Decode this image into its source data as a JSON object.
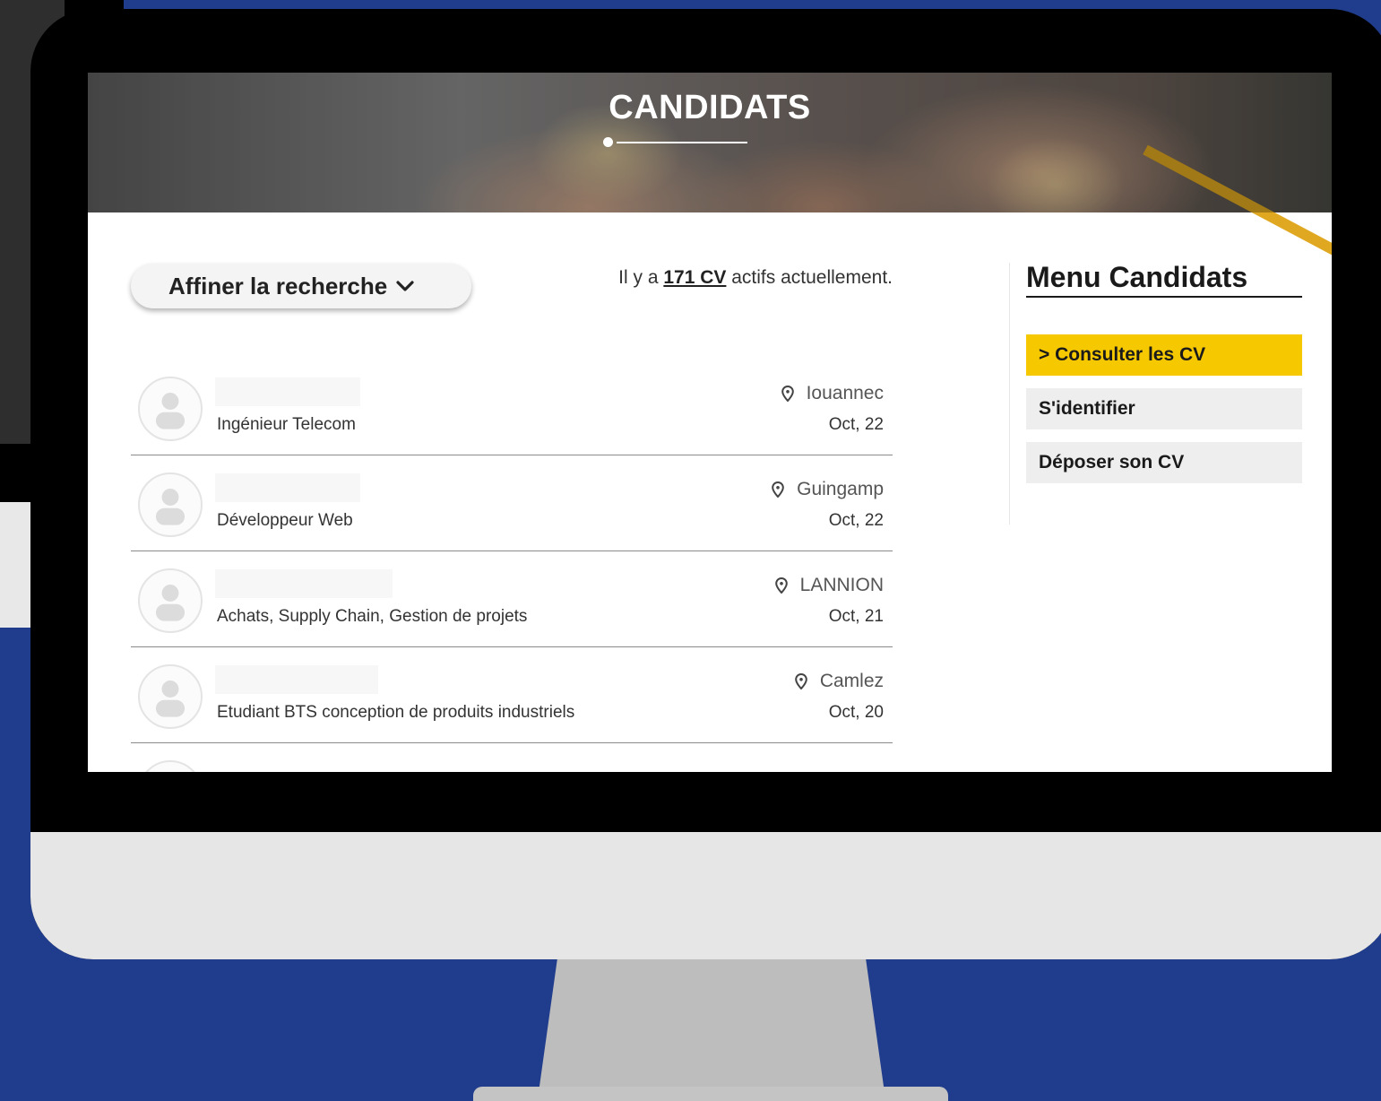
{
  "hero": {
    "title": "CANDIDATS"
  },
  "search": {
    "refine_label": "Affiner la recherche",
    "count_prefix": "Il y a ",
    "count_link": "171 CV",
    "count_suffix": " actifs actuellement."
  },
  "cvs": [
    {
      "title": "Ingénieur Telecom",
      "location": "Iouannec",
      "date": "Oct, 22"
    },
    {
      "title": "Développeur Web",
      "location": "Guingamp",
      "date": "Oct, 22"
    },
    {
      "title": "Achats, Supply Chain, Gestion de projets",
      "location": "LANNION",
      "date": "Oct, 21"
    },
    {
      "title": "Etudiant BTS conception de produits industriels",
      "location": "Camlez",
      "date": "Oct, 20"
    }
  ],
  "sidebar": {
    "title": "Menu Candidats",
    "items": [
      {
        "label": "> Consulter les CV",
        "active": true
      },
      {
        "label": "S'identifier",
        "active": false
      },
      {
        "label": "Déposer son CV",
        "active": false
      }
    ]
  },
  "colors": {
    "background": "#203c8c",
    "accent": "#f6c800",
    "menu_item": "#eeeeee"
  },
  "icons": [
    "chevron-down-icon",
    "map-pin-icon",
    "user-avatar-icon"
  ]
}
